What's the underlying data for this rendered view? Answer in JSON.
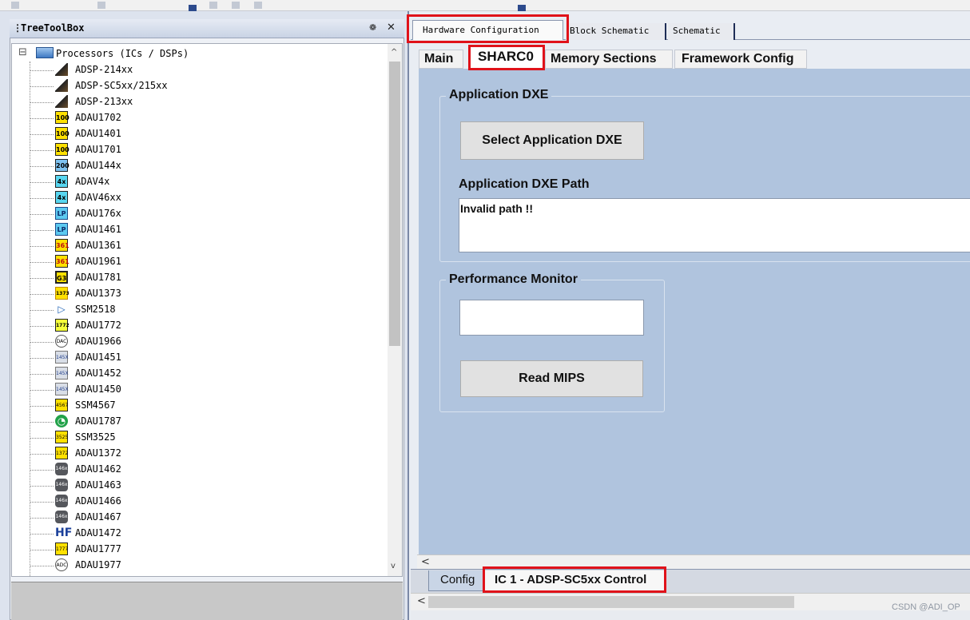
{
  "colors": {
    "accent": "#e0121a",
    "panel_bg": "#b0c4de",
    "tree_link": "#2c4a8c"
  },
  "toolbox": {
    "title": "TreeToolBox",
    "pin_glyph": "❁",
    "close_glyph": "✕"
  },
  "tree": {
    "root": {
      "expander": "⊟",
      "label": "Processors (ICs / DSPs)",
      "icon": "processor-board-icon"
    },
    "items": [
      {
        "label": "ADSP-214xx",
        "icon": "sharc-wedge-icon",
        "glyph": ""
      },
      {
        "label": "ADSP-SC5xx/215xx",
        "icon": "sharc-wedge-icon",
        "glyph": ""
      },
      {
        "label": "ADSP-213xx",
        "icon": "sharc-wedge-icon",
        "glyph": ""
      },
      {
        "label": "ADAU1702",
        "icon": "chip-100-icon",
        "glyph": "100"
      },
      {
        "label": "ADAU1401",
        "icon": "chip-100-icon",
        "glyph": "100"
      },
      {
        "label": "ADAU1701",
        "icon": "chip-100-icon",
        "glyph": "100"
      },
      {
        "label": "ADAU144x",
        "icon": "chip-200-icon",
        "glyph": "200"
      },
      {
        "label": "ADAV4x",
        "icon": "chip-4x-icon",
        "glyph": "4x"
      },
      {
        "label": "ADAV46xx",
        "icon": "chip-4x-icon",
        "glyph": "4x"
      },
      {
        "label": "ADAU176x",
        "icon": "chip-lp-icon",
        "glyph": "LP"
      },
      {
        "label": "ADAU1461",
        "icon": "chip-lp-icon",
        "glyph": "LP"
      },
      {
        "label": "ADAU1361",
        "icon": "chip-361-icon",
        "glyph": "361"
      },
      {
        "label": "ADAU1961",
        "icon": "chip-361-icon",
        "glyph": "361"
      },
      {
        "label": "ADAU1781",
        "icon": "chip-g3-icon",
        "glyph": "G3"
      },
      {
        "label": "ADAU1373",
        "icon": "chip-1373-icon",
        "glyph": "1373"
      },
      {
        "label": "SSM2518",
        "icon": "amp-triangle-icon",
        "glyph": "▷"
      },
      {
        "label": "ADAU1772",
        "icon": "chip-1772-icon",
        "glyph": "1772"
      },
      {
        "label": "ADAU1966",
        "icon": "dac-icon",
        "glyph": "DAC"
      },
      {
        "label": "ADAU1451",
        "icon": "chip-145x-icon",
        "glyph": "145X"
      },
      {
        "label": "ADAU1452",
        "icon": "chip-145x-icon",
        "glyph": "145X"
      },
      {
        "label": "ADAU1450",
        "icon": "chip-145x-icon",
        "glyph": "145X"
      },
      {
        "label": "SSM4567",
        "icon": "chip-4567-icon",
        "glyph": "4567"
      },
      {
        "label": "ADAU1787",
        "icon": "headphones-icon",
        "glyph": "◔"
      },
      {
        "label": "SSM3525",
        "icon": "chip-3525-icon",
        "glyph": "3525"
      },
      {
        "label": "ADAU1372",
        "icon": "chip-1372-icon",
        "glyph": "1372"
      },
      {
        "label": "ADAU1462",
        "icon": "chip-146x-icon",
        "glyph": "146x"
      },
      {
        "label": "ADAU1463",
        "icon": "chip-146x-icon",
        "glyph": "146x"
      },
      {
        "label": "ADAU1466",
        "icon": "chip-146x-icon",
        "glyph": "146x"
      },
      {
        "label": "ADAU1467",
        "icon": "chip-146x-icon",
        "glyph": "146x"
      },
      {
        "label": "ADAU1472",
        "icon": "hf-icon",
        "glyph": "HF"
      },
      {
        "label": "ADAU1777",
        "icon": "chip-1777-icon",
        "glyph": "1777"
      },
      {
        "label": "ADAU1977",
        "icon": "adc-icon",
        "glyph": "ADC"
      }
    ]
  },
  "top_tabs": [
    "Hardware Configuration",
    "Block Schematic",
    "Schematic"
  ],
  "inner_tabs": [
    "Main",
    "SHARC0",
    "Memory Sections",
    "Framework Config"
  ],
  "app_dxe": {
    "group_title": "Application DXE",
    "select_button": "Select Application DXE",
    "path_label": "Application DXE Path",
    "path_value": "Invalid path !!"
  },
  "perf": {
    "group_title": "Performance Monitor",
    "mips_value": "",
    "read_button": "Read MIPS"
  },
  "bottom_tabs": [
    "Config",
    "IC 1 - ADSP-SC5xx Control"
  ],
  "scroll": {
    "left_arrow": "<",
    "up_arrow": "^",
    "down_arrow": "v"
  },
  "watermark": "CSDN @ADI_OP"
}
